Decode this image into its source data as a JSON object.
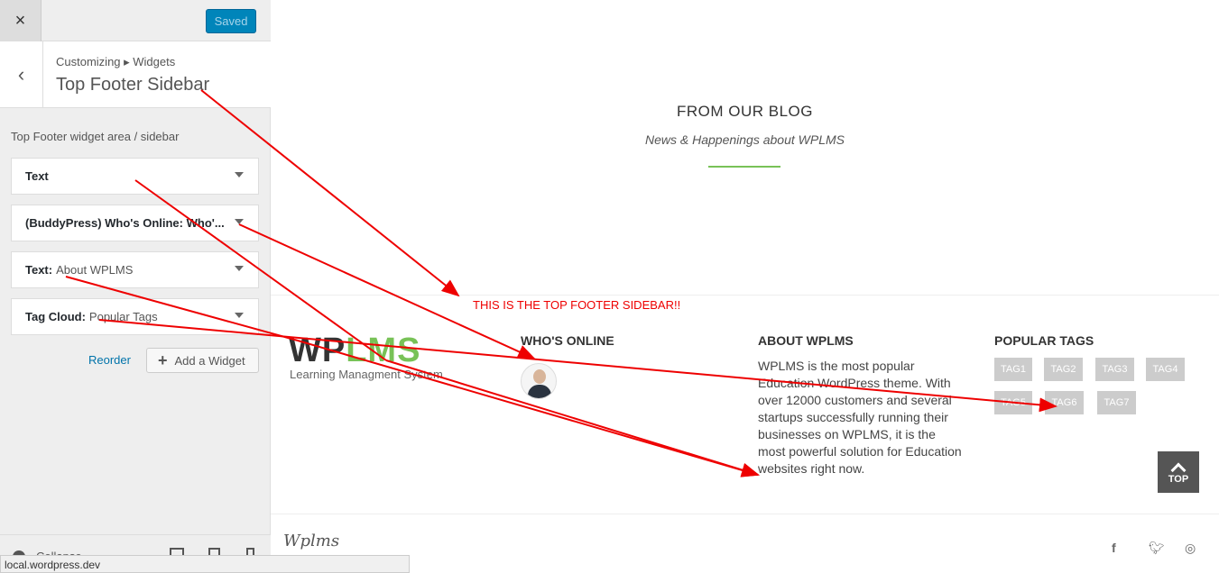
{
  "customizer": {
    "close_icon": "×",
    "saved_label": "Saved",
    "breadcrumb": "Customizing ▸ Widgets",
    "panel_title": "Top Footer Sidebar",
    "area_description": "Top Footer widget area / sidebar",
    "widgets": [
      {
        "type": "Text",
        "name": ""
      },
      {
        "type": "(BuddyPress) Who's Online: Who'...",
        "name": ""
      },
      {
        "type": "Text:",
        "name": "About WPLMS"
      },
      {
        "type": "Tag Cloud:",
        "name": "Popular Tags"
      }
    ],
    "reorder_label": "Reorder",
    "add_widget_label": "Add a Widget",
    "collapse_label": "Collapse",
    "status_url": "local.wordpress.dev"
  },
  "preview": {
    "blog_title": "FROM OUR BLOG",
    "blog_subtitle": "News & Happenings about WPLMS",
    "annotation": "THIS IS THE TOP FOOTER SIDEBAR!!",
    "logo_wp": "WP",
    "logo_lms": "LMS",
    "logo_tagline": "Learning Managment System",
    "whos_online_title": "WHO'S ONLINE",
    "about_title": "ABOUT WPLMS",
    "about_text": "WPLMS is the most popular Education WordPress theme. With over 12000 customers and several startups successfully running their businesses on WPLMS, it is the most powerful solution for Education websites right now.",
    "tags_title": "POPULAR TAGS",
    "tags": [
      "TAG1",
      "TAG2",
      "TAG3",
      "TAG4",
      "TAG5",
      "TAG6",
      "TAG7"
    ],
    "top_label": "TOP",
    "brand_small": "Wplms",
    "social_icons": [
      "facebook-icon",
      "twitter-icon",
      "dribbble-icon"
    ]
  },
  "colors": {
    "accent_green": "#78c257",
    "wp_blue": "#0085ba",
    "annotation_red": "#e00000"
  }
}
